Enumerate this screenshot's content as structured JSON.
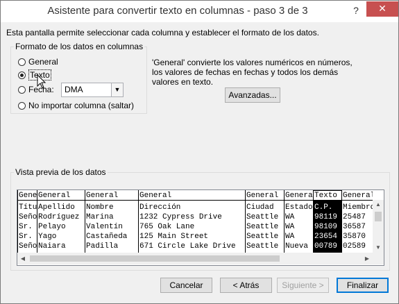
{
  "window": {
    "title": "Asistente para convertir texto en columnas - paso 3 de 3",
    "help": "?",
    "close": "✕"
  },
  "description": "Esta pantalla permite seleccionar cada columna y establecer el formato de los datos.",
  "format_group": {
    "legend": "Formato de los datos en columnas",
    "options": [
      {
        "label": "General",
        "selected": false
      },
      {
        "label": "Texto",
        "selected": true
      },
      {
        "label": "Fecha:",
        "selected": false
      },
      {
        "label": "No importar columna (saltar)",
        "selected": false
      }
    ],
    "date_format": "DMA"
  },
  "info_text": "'General' convierte los valores numéricos en números, los valores de fechas en fechas y todos los demás valores en texto.",
  "advanced_button": "Avanzadas...",
  "preview": {
    "legend": "Vista previa de los datos",
    "columns": [
      {
        "header": "General",
        "cells": [
          "Título",
          "Señor",
          "Sr.",
          "Sr.",
          "Señora"
        ]
      },
      {
        "header": "General",
        "cells": [
          "Apellido",
          "Rodríguez",
          "Pelayo",
          "Yago",
          "Naiara"
        ]
      },
      {
        "header": "General",
        "cells": [
          "Nombre",
          "Marina",
          "Valentín",
          "Castañeda",
          "Padilla"
        ]
      },
      {
        "header": "General",
        "cells": [
          "Dirección",
          "1232 Cypress Drive",
          "765 Oak Lane",
          "125 Main Street",
          "671 Circle Lake Drive"
        ]
      },
      {
        "header": "General",
        "cells": [
          "Ciudad",
          "Seattle",
          "Seattle",
          "Seattle",
          "Seattle"
        ]
      },
      {
        "header": "General",
        "cells": [
          "Estado",
          "WA",
          "WA",
          "WA",
          "Nueva"
        ]
      },
      {
        "header": "Texto",
        "cells": [
          "C.P.",
          "98119",
          "98109",
          "23654",
          "00789"
        ]
      },
      {
        "header": "General",
        "cells": [
          "Miembro",
          "25487",
          "36587",
          "35870",
          "02589"
        ]
      }
    ]
  },
  "buttons": {
    "cancel": "Cancelar",
    "back": "< Atrás",
    "next": "Siguiente >",
    "finish": "Finalizar"
  }
}
